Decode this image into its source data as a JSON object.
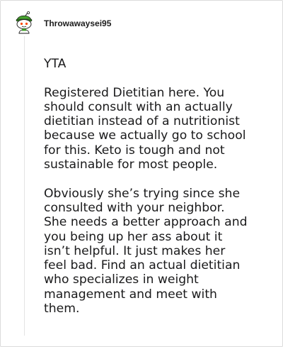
{
  "comment": {
    "author": {
      "username": "Throwawaysei95",
      "avatar_icon": "snoo-avatar-icon"
    },
    "paragraphs": [
      "YTA",
      "Registered Dietitian here. You\nshould consult with an actually\ndietitian instead of a nutritionist\nbecause we actually go to school\nfor this. Keto is tough and not\nsustainable for most people.",
      "Obviously she’s trying since she\nconsulted with your neighbor.\nShe needs a better approach and\nyou being up her ass about it\nisn’t helpful. It just makes her\nfeel bad. Find an actual dietitian\nwho specializes in weight\nmanagement and meet with\nthem."
    ]
  },
  "colors": {
    "text": "#1a1a1b",
    "border": "#dcdcdc",
    "thread_line": "#e3e3e3",
    "avatar_green": "#46a32e",
    "avatar_red": "#ff4500"
  }
}
